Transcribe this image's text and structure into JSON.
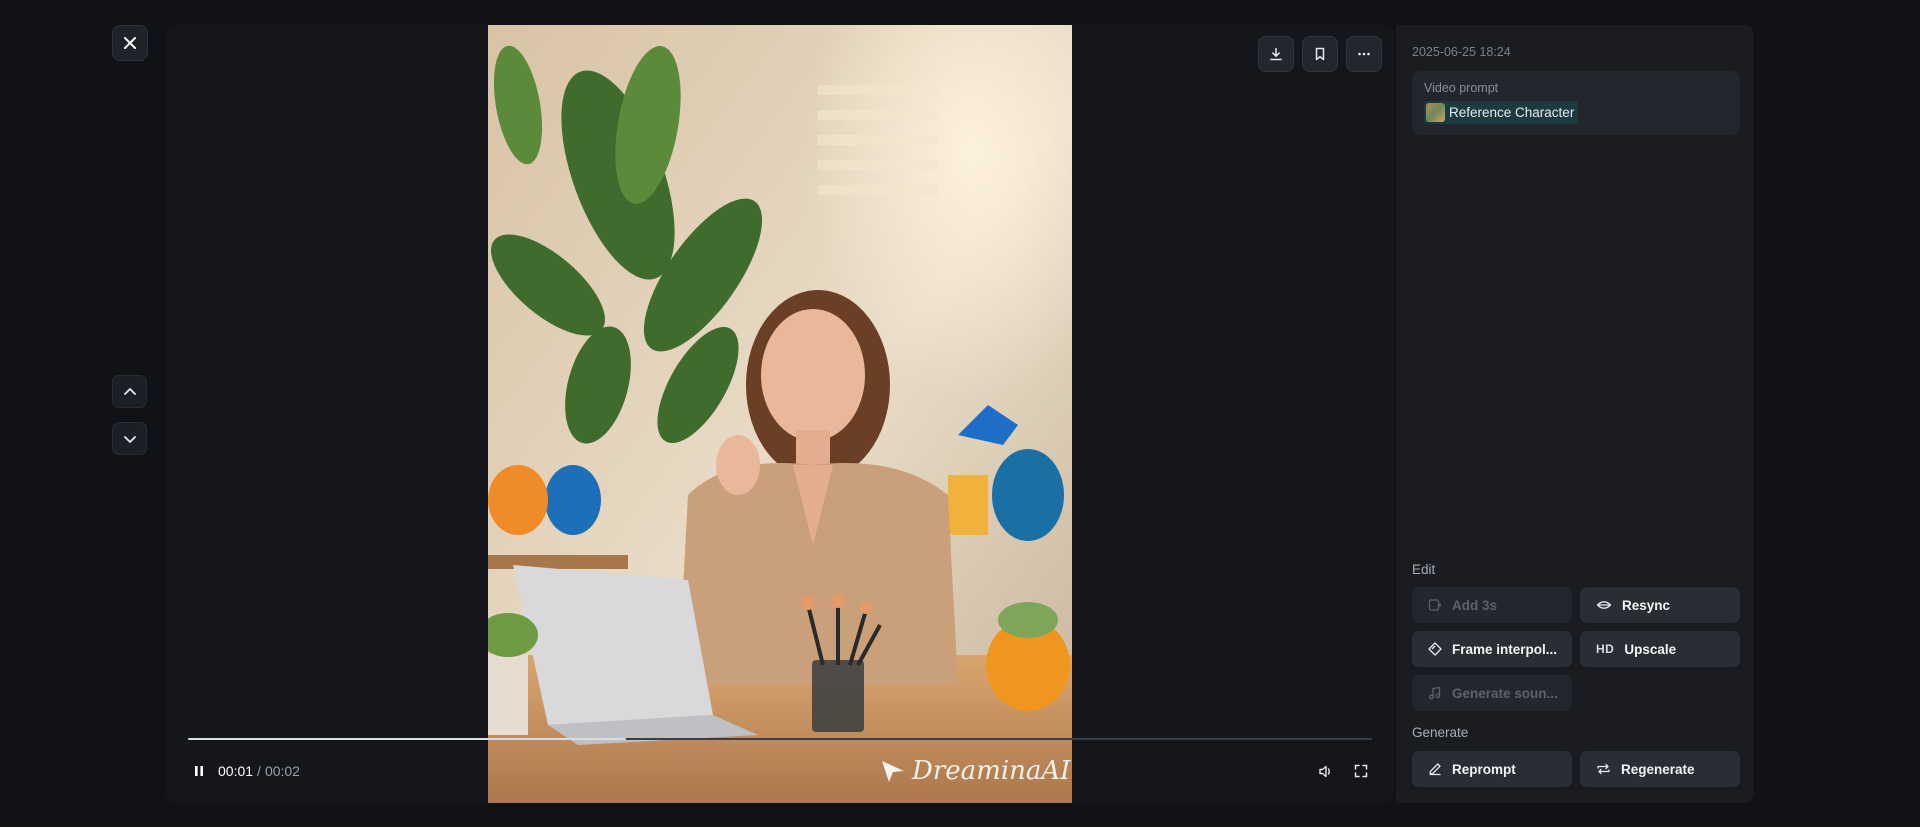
{
  "player": {
    "time_current": "00:01",
    "time_separator": "/",
    "time_total": "00:02",
    "progress_fraction": 0.37,
    "watermark": "DreaminaAI"
  },
  "panel": {
    "date": "2025-06-25 18:24",
    "prompt_label": "Video prompt",
    "prompt_chip": "Reference Character",
    "edit_label": "Edit",
    "generate_label": "Generate",
    "buttons": {
      "add3s": "Add 3s",
      "resync": "Resync",
      "frame_interp": "Frame interpol...",
      "upscale": "Upscale",
      "upscale_badge": "HD",
      "gen_sound": "Generate soun...",
      "reprompt": "Reprompt",
      "regenerate": "Regenerate"
    }
  },
  "icons": {
    "close": "close-icon",
    "up": "chevron-up-icon",
    "down": "chevron-down-icon",
    "download": "download-icon",
    "bookmark": "bookmark-icon",
    "more": "more-icon",
    "pause": "pause-icon",
    "volume": "volume-icon",
    "fullscreen": "fullscreen-icon"
  }
}
